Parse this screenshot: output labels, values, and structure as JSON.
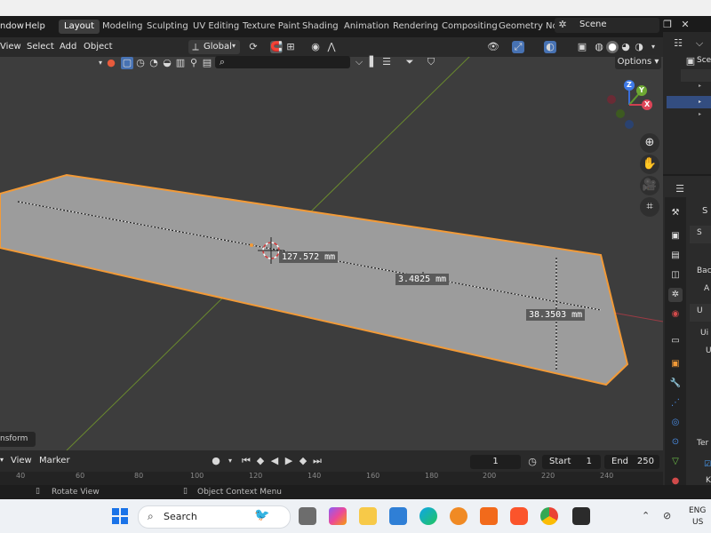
{
  "top_menu": {
    "window_label": "ndow",
    "help_label": "Help"
  },
  "workspace_tabs": [
    "Layout",
    "Modeling",
    "Sculpting",
    "UV Editing",
    "Texture Paint",
    "Shading",
    "Animation",
    "Rendering",
    "Compositing",
    "Geometry Noc"
  ],
  "scene_name": "Scene",
  "viewport_header": {
    "view": "View",
    "select": "Select",
    "add": "Add",
    "object": "Object",
    "orientation": "Global"
  },
  "options_label": "Options",
  "measurements": {
    "diagonal": "127.572 mm",
    "thickness": "3.4825 mm",
    "width": "38.3503 mm"
  },
  "transform_panel_label": "nsform",
  "gizmo": {
    "z": "Z",
    "y": "Y",
    "x": "X"
  },
  "outliner": {
    "scene_label": "Scer"
  },
  "properties": {
    "b1": "S",
    "b2": "S",
    "b3": "Bac",
    "b4": "A",
    "b5": "U",
    "b6": "Ui",
    "b7": "U",
    "b8": "Ter",
    "b9": "K"
  },
  "timeline": {
    "view": "View",
    "marker": "Marker",
    "current_frame": "1",
    "start_label": "Start",
    "start_value": "1",
    "end_label": "End",
    "end_value": "250"
  },
  "ruler_ticks": [
    "40",
    "60",
    "80",
    "100",
    "120",
    "140",
    "160",
    "180",
    "200",
    "220",
    "240"
  ],
  "statusbar": {
    "rotate": "Rotate View",
    "context": "Object Context Menu"
  },
  "taskbar": {
    "search_label": "Search",
    "lang1": "ENG",
    "lang2": "US"
  }
}
